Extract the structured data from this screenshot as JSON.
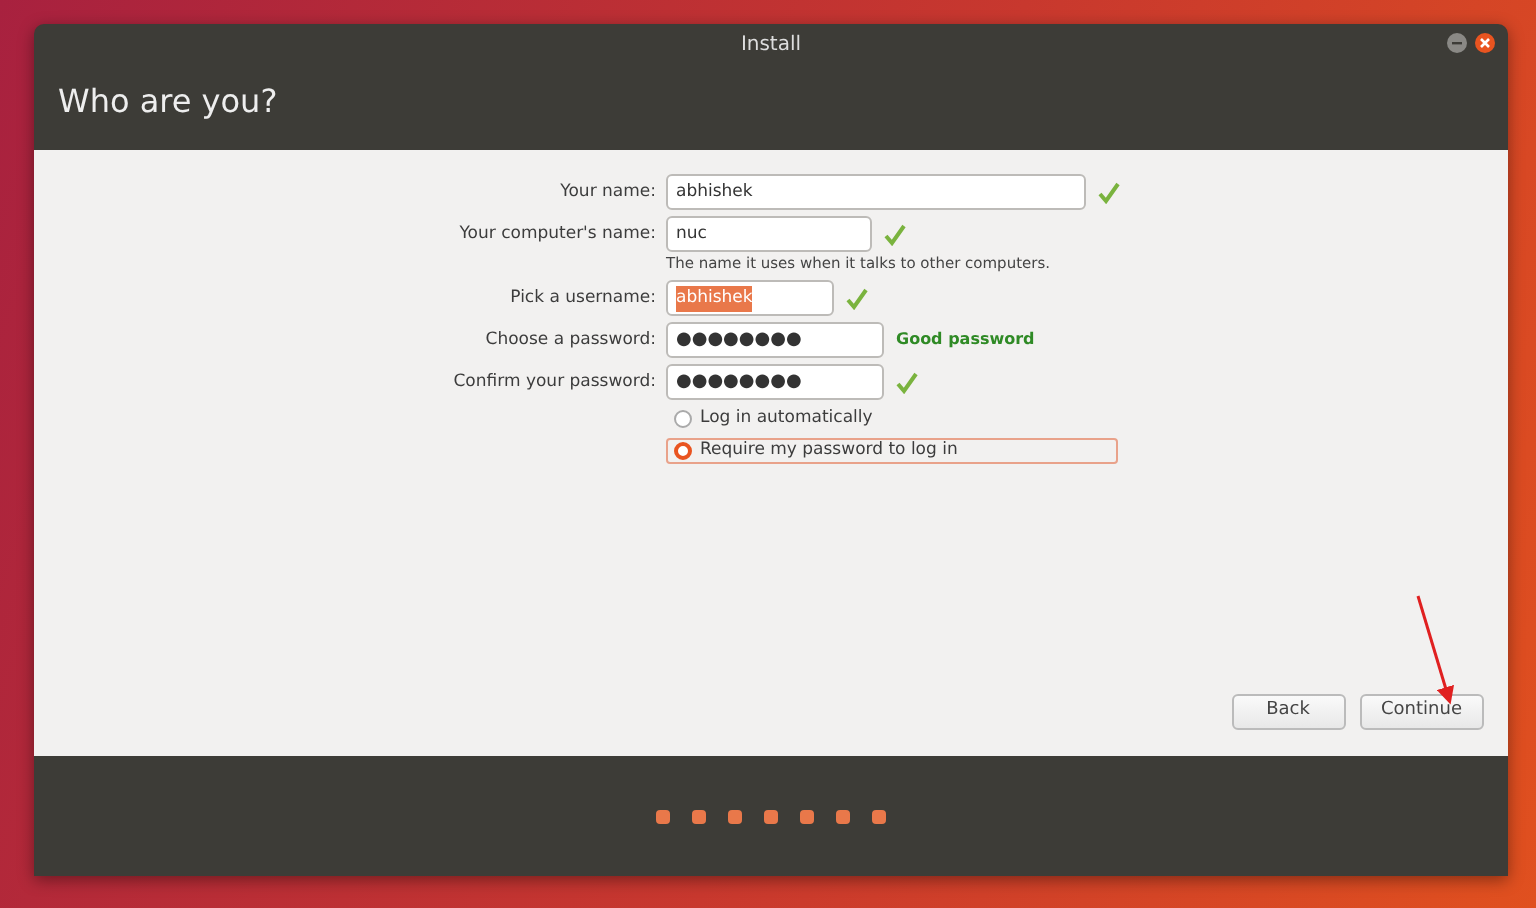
{
  "window": {
    "title": "Install"
  },
  "page_title": "Who are you?",
  "fields": [
    {
      "label": "Your name:",
      "value": "abhishek",
      "kind": "text",
      "valid": true,
      "text_selected": false
    },
    {
      "label": "Your computer's name:",
      "value": "nuc",
      "kind": "text",
      "valid": true,
      "text_selected": false,
      "hint": "The name it uses when it talks to other computers."
    },
    {
      "label": "Pick a username:",
      "value": "abhishek",
      "kind": "text",
      "valid": true,
      "text_selected": true
    },
    {
      "label": "Choose a password:",
      "value": "●●●●●●●●",
      "kind": "password",
      "valid": false,
      "text_selected": false,
      "strength": "Good password"
    },
    {
      "label": "Confirm your password:",
      "value": "●●●●●●●●",
      "kind": "password",
      "valid": true,
      "text_selected": false
    }
  ],
  "login_options": [
    {
      "label": "Log in automatically",
      "selected": false
    },
    {
      "label": "Require my password to log in",
      "selected": true
    }
  ],
  "buttons": [
    "Back",
    "Continue"
  ]
}
